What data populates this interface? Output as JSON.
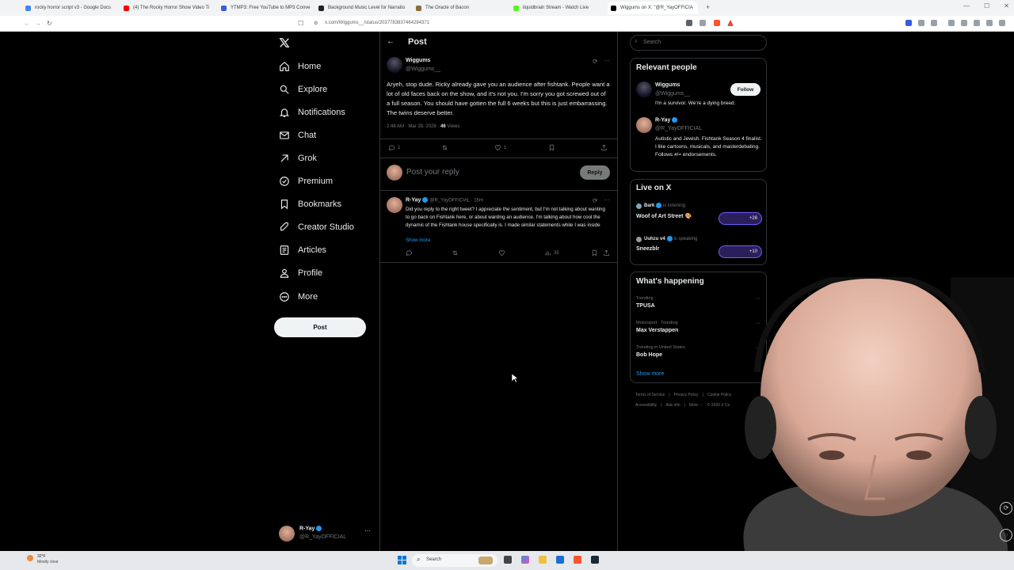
{
  "browser": {
    "tabs": [
      {
        "label": "rocky horror script v3 - Google Docs",
        "color": "#4285f4"
      },
      {
        "label": "(4) The Rocky Horror Show Video Ti",
        "color": "#ff0000"
      },
      {
        "label": "YTMP3: Free YouTube to MP3 Conve",
        "color": "#3b5bdb"
      },
      {
        "label": "Background Music Level for Narratio",
        "color": "#222222"
      },
      {
        "label": "The Oracle of Bacon",
        "color": "#8a6d3b"
      },
      {
        "label": "liquidbrain Stream - Watch Live",
        "color": "#53fc18"
      },
      {
        "label": "Wiggums on X: \"@R_YayOFFICIA",
        "color": "#000000"
      }
    ],
    "new_tab": "+",
    "url": "x.com/Wiggums__/status/2037783837464294371"
  },
  "nav": {
    "items": [
      {
        "label": "Home",
        "icon": "home-icon"
      },
      {
        "label": "Explore",
        "icon": "search-icon"
      },
      {
        "label": "Notifications",
        "icon": "bell-icon"
      },
      {
        "label": "Chat",
        "icon": "mail-icon"
      },
      {
        "label": "Grok",
        "icon": "grok-icon"
      },
      {
        "label": "Premium",
        "icon": "premium-icon"
      },
      {
        "label": "Bookmarks",
        "icon": "bookmark-icon"
      },
      {
        "label": "Creator Studio",
        "icon": "rocket-icon"
      },
      {
        "label": "Articles",
        "icon": "article-icon"
      },
      {
        "label": "Profile",
        "icon": "person-icon"
      },
      {
        "label": "More",
        "icon": "more-circle-icon"
      }
    ],
    "post_label": "Post",
    "account": {
      "name": "R-Yay",
      "handle": "@R_YayOFFICIAL"
    }
  },
  "main": {
    "header": "Post",
    "tweet": {
      "author": "Wiggums",
      "handle": "@Wiggums__",
      "text": "Aryeh, stop dude. Ricky already gave you an audience after fishtank. People want a lot of old faces back on the show, and it's not you. I'm sorry you got screwed out of a full season. You should have gotten the full 6 weeks but this is just embarrassing. The twins deserve better.",
      "time": "2:48 AM · Mar 28, 2026 · ",
      "views_count": "46",
      "views_label": " Views",
      "replies": "1",
      "likes": "1"
    },
    "reply_box": {
      "placeholder": "Post your reply",
      "button": "Reply"
    },
    "reply": {
      "author": "R-Yay",
      "handle": "@R_YayOFFICIAL · 16m",
      "text": "Did you reply to the right tweet? I appreciate the sentiment, but I'm not talking about wanting to go back on Fishtank here, or about wanting an audience. I'm talking about how cool the dynamic of the Fishtank house specifically is. I made similar statements while I was inside",
      "show_more": "Show more",
      "views": "35"
    }
  },
  "sidebar": {
    "search_placeholder": "Search",
    "relevant": {
      "title": "Relevant people",
      "people": [
        {
          "name": "Wiggums",
          "handle": "@Wiggums__",
          "bio": "I'm a survivor. We're a dying breed.",
          "follow": "Follow"
        },
        {
          "name": "R-Yay",
          "handle": "@R_YayOFFICIAL",
          "bio": "Autistic and Jewish. Fishtank Season 4 finalist. I like cartoons, musicals, and masterdebating. Follows ≠/= endorsements."
        }
      ]
    },
    "live": {
      "title": "Live on X",
      "items": [
        {
          "host": "Bark",
          "status": "is listening",
          "title": "Woof of Art Street 🎨",
          "count": "+26"
        },
        {
          "host": "Uuhzu v4",
          "status": "is speaking",
          "title": "Sneezblr",
          "count": "+10"
        }
      ]
    },
    "happening": {
      "title": "What's happening",
      "items": [
        {
          "context": "Trending",
          "topic": "TPUSA"
        },
        {
          "context": "Motorsport · Trending",
          "topic": "Max Verstappen"
        },
        {
          "context": "Trending in United States",
          "topic": "Bob Hope"
        }
      ],
      "show_more": "Show more"
    },
    "footer": {
      "line1": [
        "Terms of Service",
        "|",
        "Privacy Policy",
        "|",
        "Cookie Policy"
      ],
      "line2": [
        "Accessibility",
        "|",
        "Ads info",
        "|",
        "More ···",
        "© 2026 X Co"
      ]
    }
  },
  "taskbar": {
    "weather_temp": "32°F",
    "weather_desc": "Mostly clear",
    "search_placeholder": "Search"
  }
}
